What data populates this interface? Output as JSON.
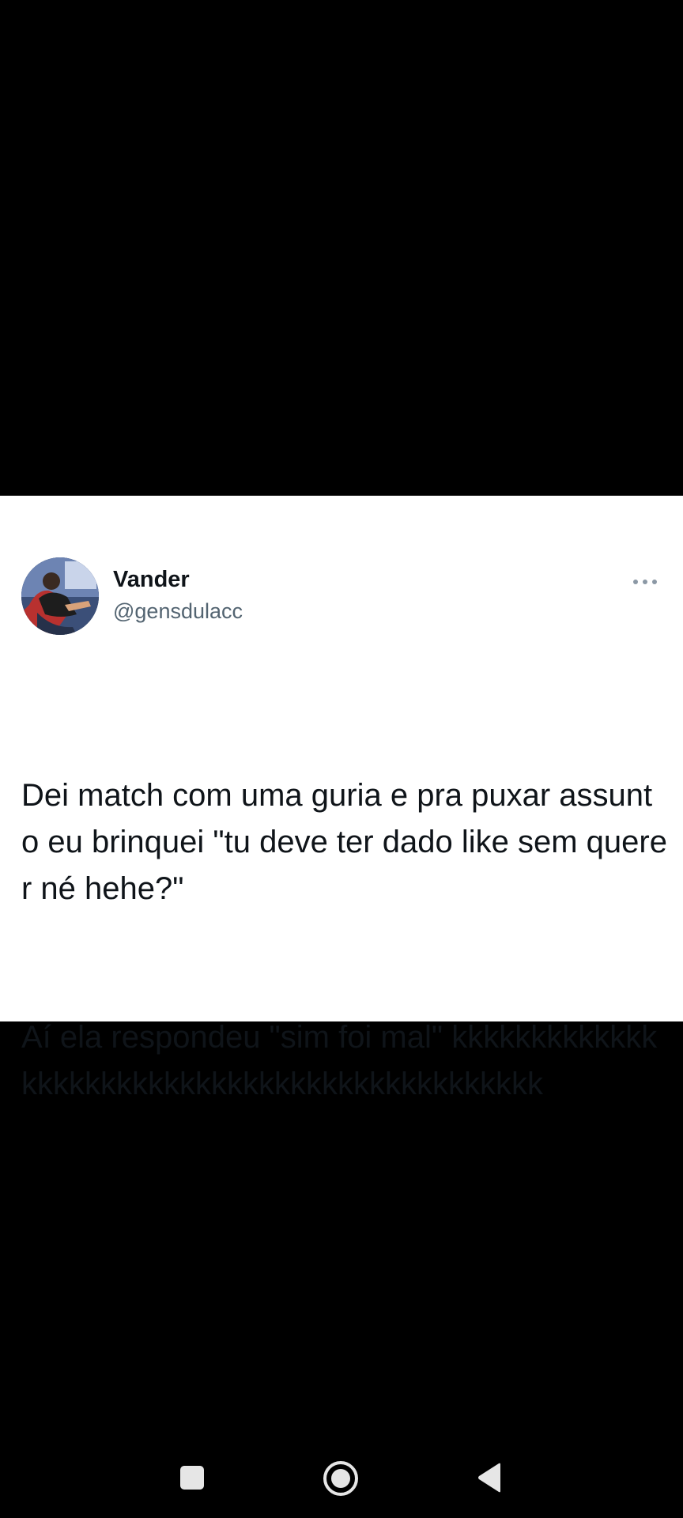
{
  "tweet": {
    "display_name": "Vander",
    "handle": "@gensdulacc",
    "paragraphs": [
      "Dei match com uma guria e pra puxar assunto eu brinquei \"tu deve ter dado like sem querer né hehe?\"",
      "Aí ela respondeu \"sim foi mal\" kkkkkkkkkkkkkkkkkkkkkkkkkkkkkkkkkkkkkkkkkkkkkk"
    ],
    "avatar_icon": "profile-photo",
    "more_icon": "ellipsis-icon"
  },
  "navigation_bar": {
    "buttons": [
      {
        "name": "recents",
        "icon": "square-icon"
      },
      {
        "name": "home",
        "icon": "circle-home-icon"
      },
      {
        "name": "back",
        "icon": "triangle-back-icon"
      }
    ]
  },
  "colors": {
    "background": "#000000",
    "card": "#ffffff",
    "text_primary": "#0f1419",
    "text_secondary": "#536471",
    "nav_icon": "#e6e6e6"
  }
}
